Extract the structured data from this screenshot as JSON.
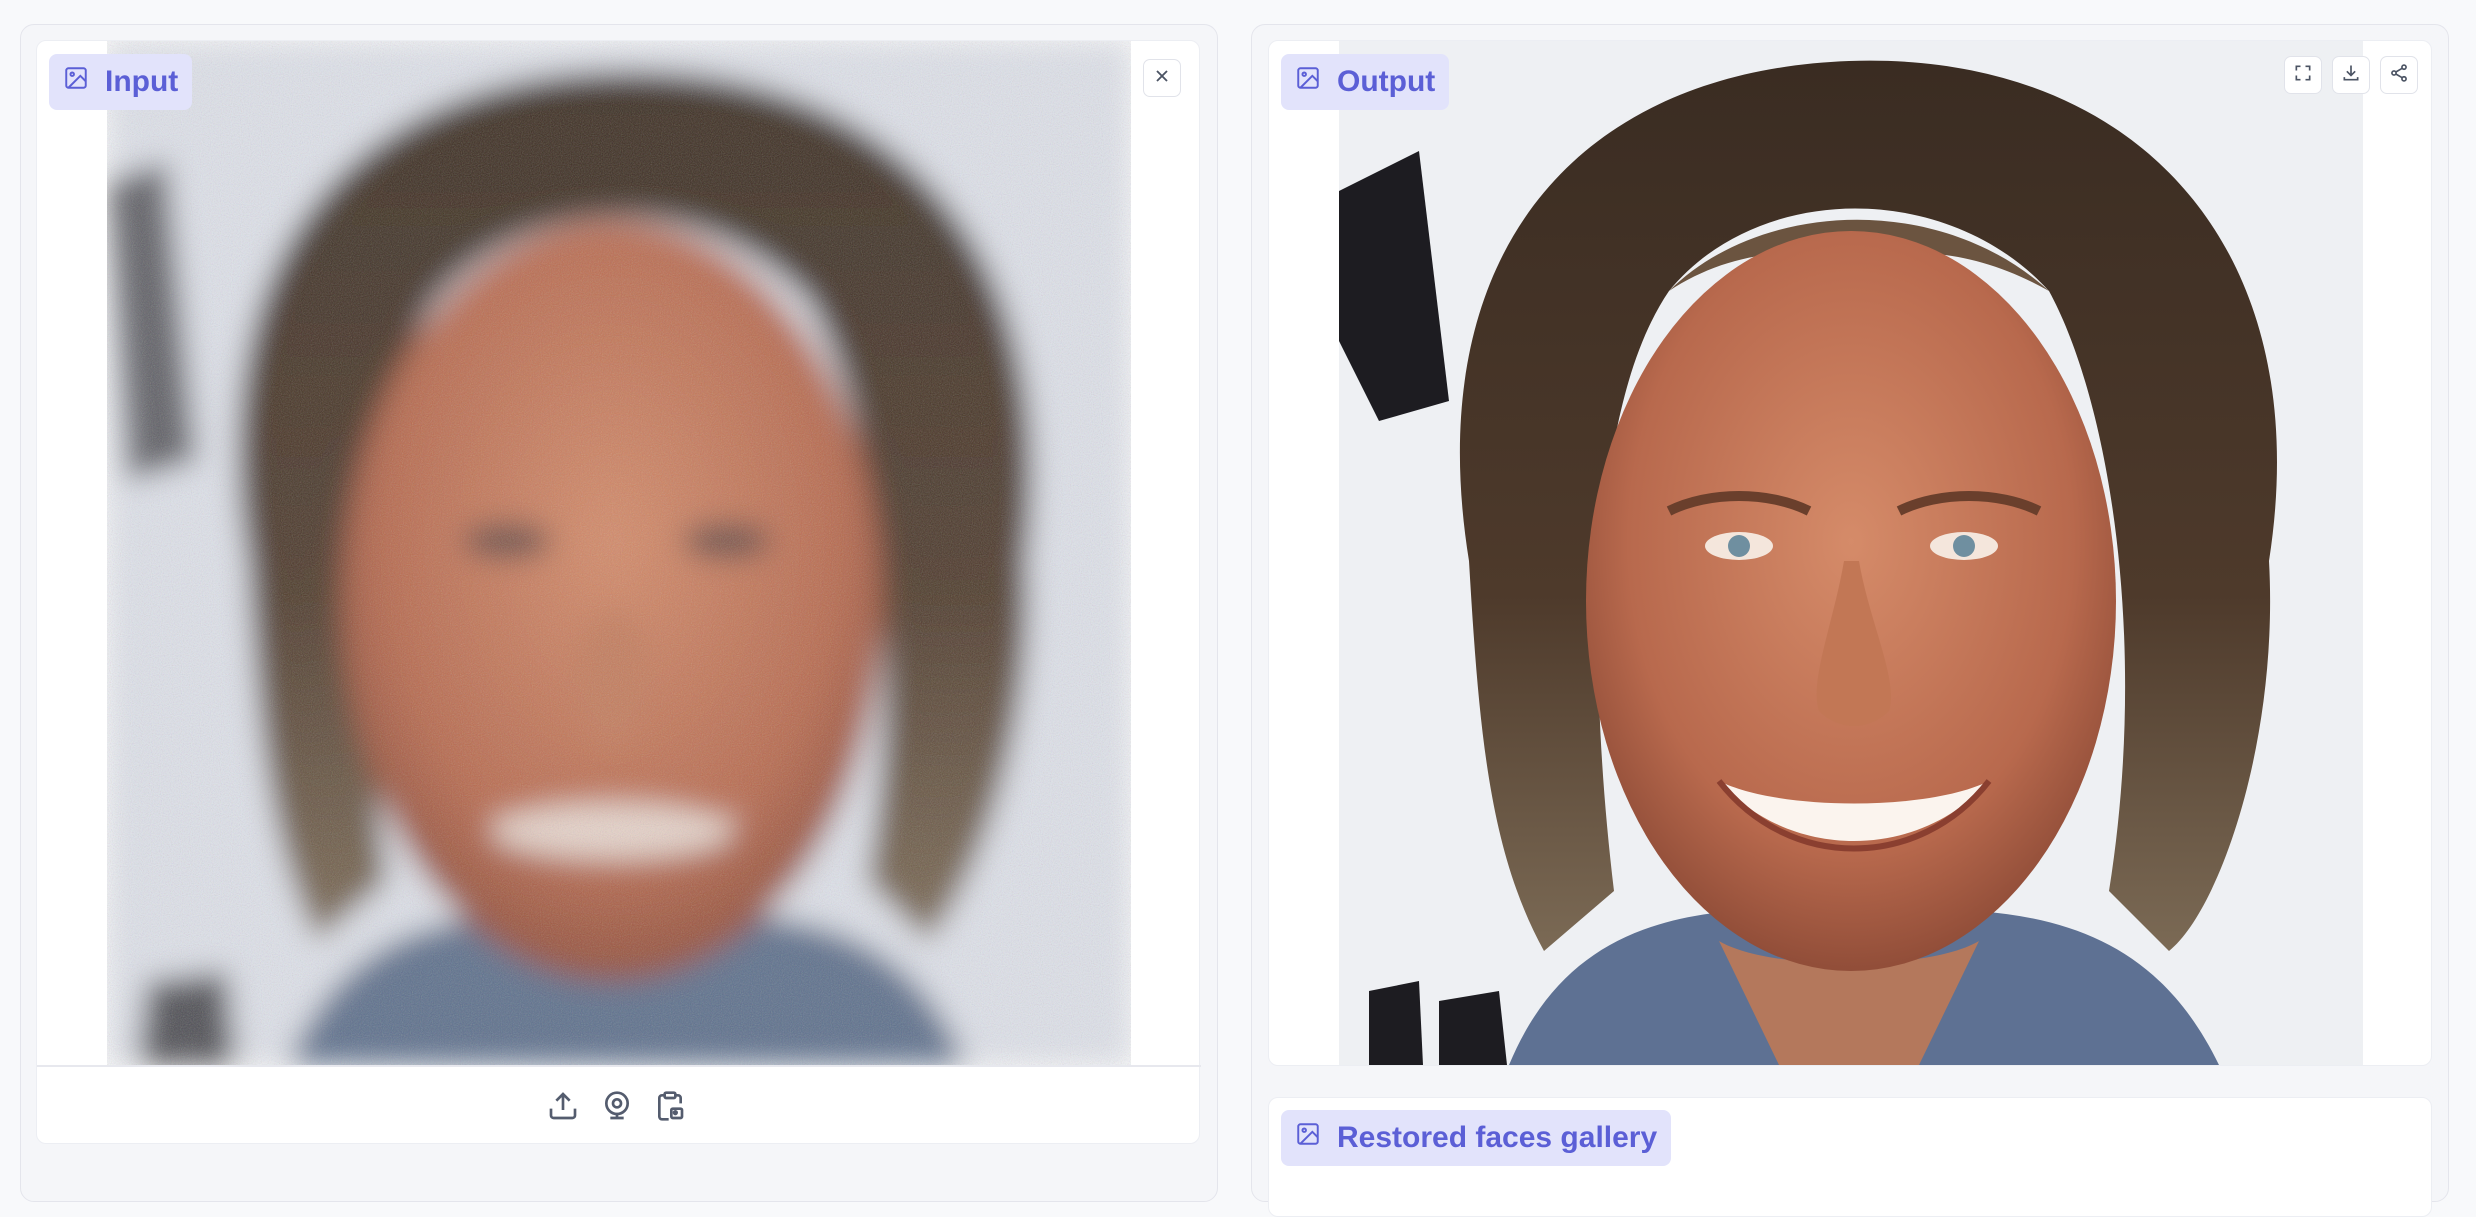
{
  "input_panel": {
    "label": "Input",
    "image_icon": "image-icon",
    "close_icon": "close-icon",
    "source_icons": [
      "upload-icon",
      "webcam-icon",
      "clipboard-icon"
    ]
  },
  "output_panel": {
    "label": "Output",
    "image_icon": "image-icon",
    "action_icons": [
      "fullscreen-icon",
      "download-icon",
      "share-icon"
    ]
  },
  "gallery_panel": {
    "label": "Restored faces gallery",
    "image_icon": "image-icon"
  },
  "colors": {
    "badge_bg": "#e2e3fb",
    "badge_text": "#5b5fd6",
    "panel_border": "#e4e5ec"
  }
}
